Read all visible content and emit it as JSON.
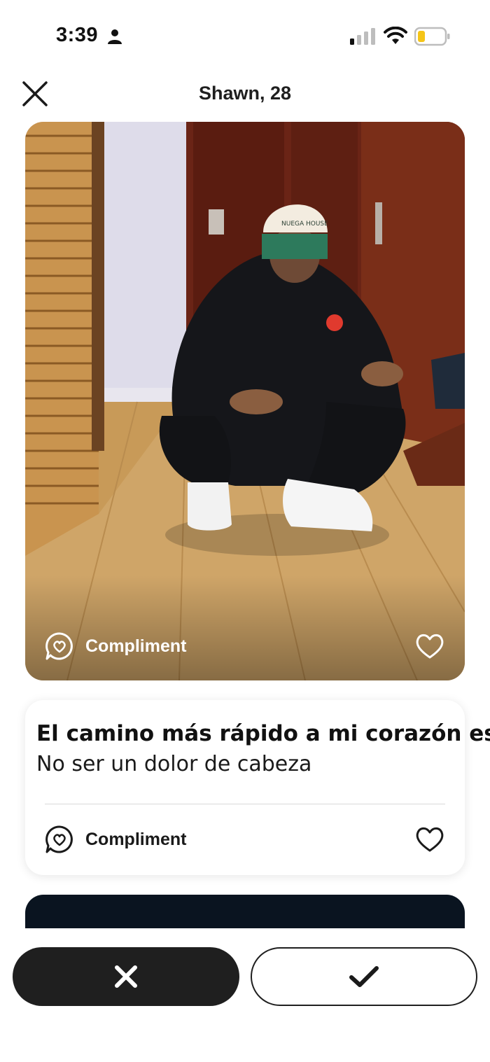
{
  "status_bar": {
    "time": "3:39",
    "icons": [
      "person-icon",
      "signal-icon",
      "wifi-icon",
      "battery-icon"
    ],
    "battery_color": "#f5c518"
  },
  "header": {
    "title": "Shawn, 28",
    "close_icon": "close-icon"
  },
  "photo_card": {
    "compliment_label": "Compliment",
    "like_icon": "heart-icon",
    "cap_text": "NUEGA HOUSE"
  },
  "prompt_card": {
    "question": "El camino más rápido a mi corazón es",
    "answer": "No ser un dolor de cabeza",
    "compliment_label": "Compliment",
    "like_icon": "heart-icon"
  },
  "actions": {
    "reject_icon": "x-icon",
    "accept_icon": "check-icon"
  },
  "colors": {
    "dark": "#1f1f1f",
    "background": "#ffffff",
    "next_card": "#0a1420"
  }
}
